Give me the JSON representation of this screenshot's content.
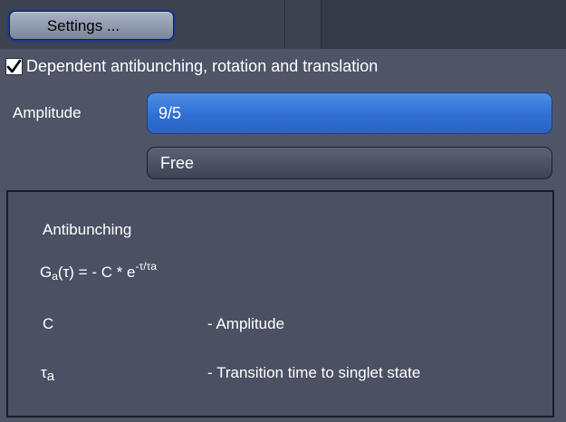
{
  "toolbar": {
    "settings_label": "Settings ..."
  },
  "options": {
    "dependent_checkbox_checked": true,
    "dependent_checkbox_label": "Dependent antibunching, rotation and translation",
    "amplitude_label": "Amplitude",
    "amplitude_value": "9/5",
    "mode_value": "Free"
  },
  "formula": {
    "heading": "Antibunching",
    "equation_lhs_G": "G",
    "equation_lhs_sub": "a",
    "equation_lhs_arg": "(τ) =  - C * e",
    "equation_exponent": "-τ/τa",
    "param_C_symbol": "C",
    "param_C_desc": "- Amplitude",
    "param_tau_symbol": "τ",
    "param_tau_sub": "a",
    "param_tau_desc": "- Transition time to singlet state"
  },
  "colors": {
    "selected_field": "#2f6fd4",
    "panel_background": "#4f5567"
  }
}
